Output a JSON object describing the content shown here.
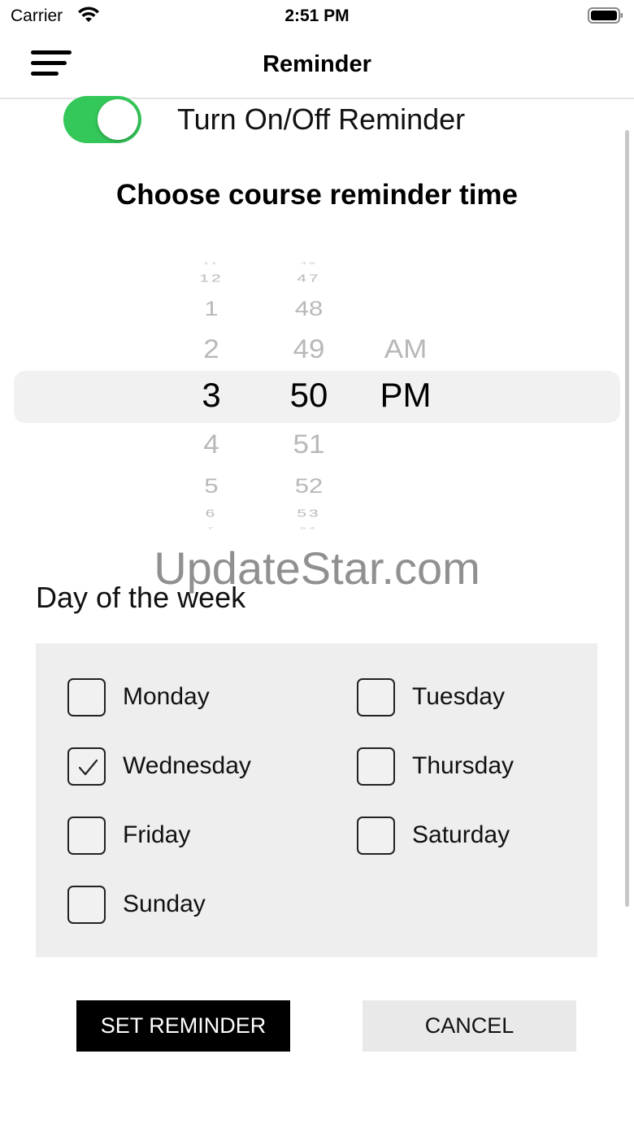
{
  "status_bar": {
    "carrier": "Carrier",
    "time": "2:51 PM"
  },
  "nav": {
    "title": "Reminder",
    "menu_icon": "hamburger-menu-icon"
  },
  "reminder_toggle": {
    "label": "Turn On/Off Reminder",
    "on": true,
    "color": "#34c759"
  },
  "time_section": {
    "heading": "Choose course reminder time"
  },
  "time_picker": {
    "hours": {
      "selected": "3",
      "above": [
        "2",
        "1",
        "12",
        "11"
      ],
      "below": [
        "4",
        "5",
        "6",
        "7"
      ]
    },
    "minutes": {
      "selected": "50",
      "above": [
        "49",
        "48",
        "47",
        "46"
      ],
      "below": [
        "51",
        "52",
        "53",
        "54"
      ]
    },
    "period": {
      "selected": "PM",
      "above": [
        "AM"
      ]
    }
  },
  "watermark": "UpdateStar.com",
  "days_section": {
    "label": "Day of the week",
    "days": [
      {
        "name": "Monday",
        "checked": false
      },
      {
        "name": "Tuesday",
        "checked": false
      },
      {
        "name": "Wednesday",
        "checked": true
      },
      {
        "name": "Thursday",
        "checked": false
      },
      {
        "name": "Friday",
        "checked": false
      },
      {
        "name": "Saturday",
        "checked": false
      },
      {
        "name": "Sunday",
        "checked": false
      }
    ]
  },
  "buttons": {
    "set_reminder": "SET REMINDER",
    "cancel": "CANCEL"
  }
}
